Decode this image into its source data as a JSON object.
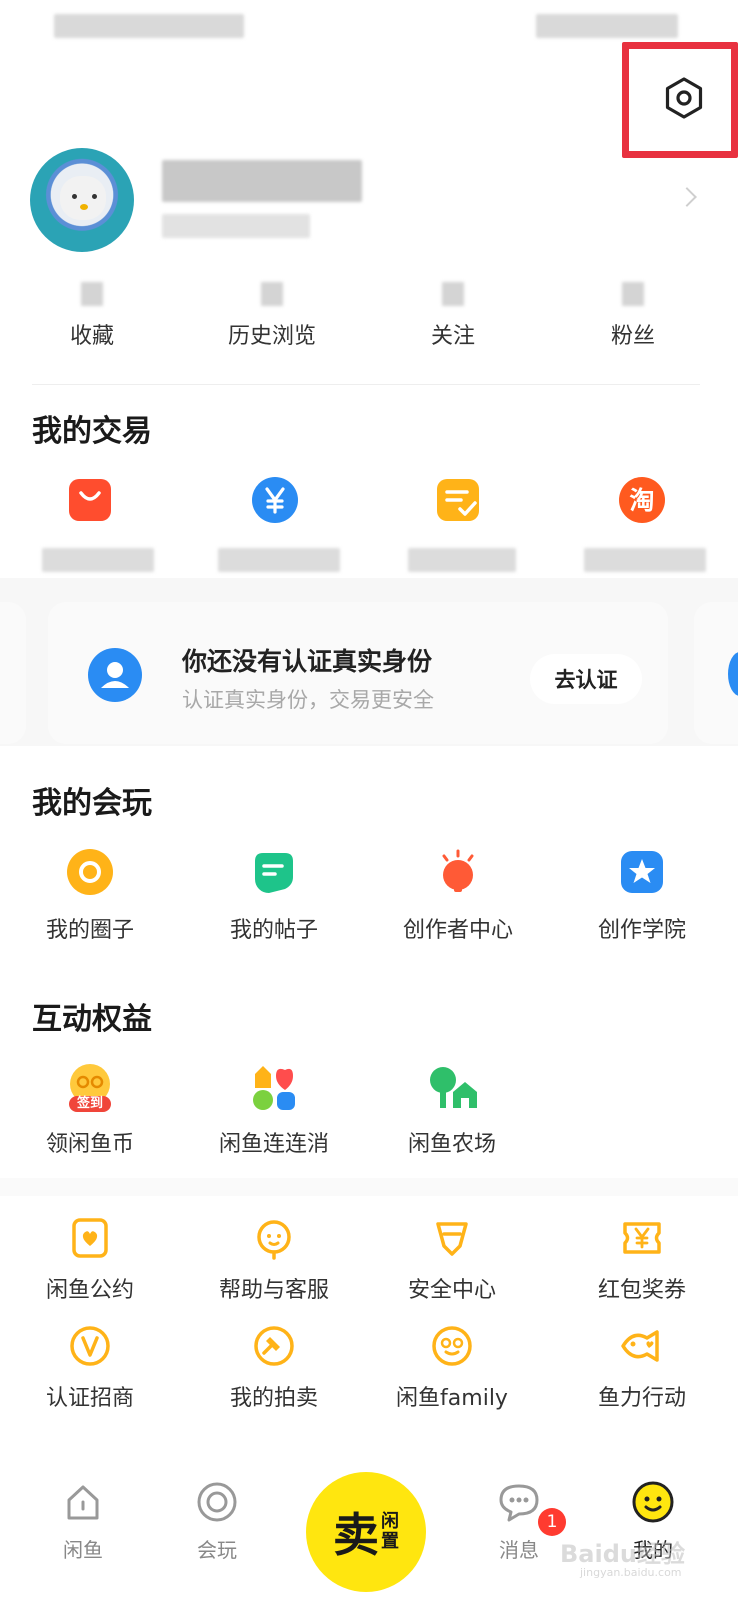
{
  "stats": [
    "收藏",
    "历史浏览",
    "关注",
    "粉丝"
  ],
  "trade": {
    "title": "我的交易",
    "items": [
      {
        "icon": "shopping-bag-icon",
        "color": "#ff4d2e"
      },
      {
        "icon": "yuan-icon",
        "color": "#2a8cf3"
      },
      {
        "icon": "order-check-icon",
        "color": "#ffb318"
      },
      {
        "icon": "taobao-icon",
        "color": "#ff5a1f",
        "glyph": "淘"
      }
    ]
  },
  "verify": {
    "title": "你还没有认证真实身份",
    "subtitle": "认证真实身份，交易更安全",
    "button": "去认证"
  },
  "play": {
    "title": "我的会玩",
    "items": [
      "我的圈子",
      "我的帖子",
      "创作者中心",
      "创作学院"
    ]
  },
  "rights": {
    "title": "互动权益",
    "items": [
      "领闲鱼币",
      "闲鱼连连消",
      "闲鱼农场"
    ],
    "checkin_badge": "签到"
  },
  "services": {
    "row1": [
      "闲鱼公约",
      "帮助与客服",
      "安全中心",
      "红包奖券"
    ],
    "row2": [
      "认证招商",
      "我的拍卖",
      "闲鱼family",
      "鱼力行动"
    ]
  },
  "tabbar": {
    "tabs": [
      "闲鱼",
      "会玩",
      "消息",
      "我的"
    ],
    "sell_main": "卖",
    "sell_sub1": "闲",
    "sell_sub2": "置",
    "message_badge": "1"
  },
  "watermark": {
    "text": "Baidu经验",
    "sub": "jingyan.baidu.com"
  },
  "colors": {
    "accent": "#ffe60f",
    "highlight": "#e8313f",
    "orange": "#ffb318"
  }
}
